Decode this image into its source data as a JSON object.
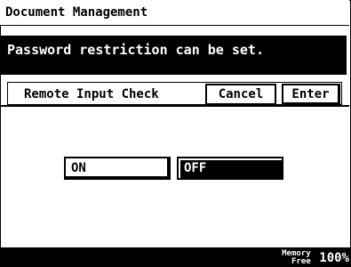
{
  "header": {
    "title": "Document Management"
  },
  "message": {
    "text": "Password restriction can be set."
  },
  "tabrow": {
    "label": "Remote Input Check",
    "cancel_label": "Cancel",
    "enter_label": "Enter"
  },
  "options": {
    "on_label": "ON",
    "off_label": "OFF",
    "selected": "OFF"
  },
  "status": {
    "memory_label_line1": "Memory",
    "memory_label_line2": "Free",
    "memory_value": "100%"
  },
  "colors": {
    "background": "#ffffff",
    "foreground": "#000000",
    "selected": "#000000"
  }
}
